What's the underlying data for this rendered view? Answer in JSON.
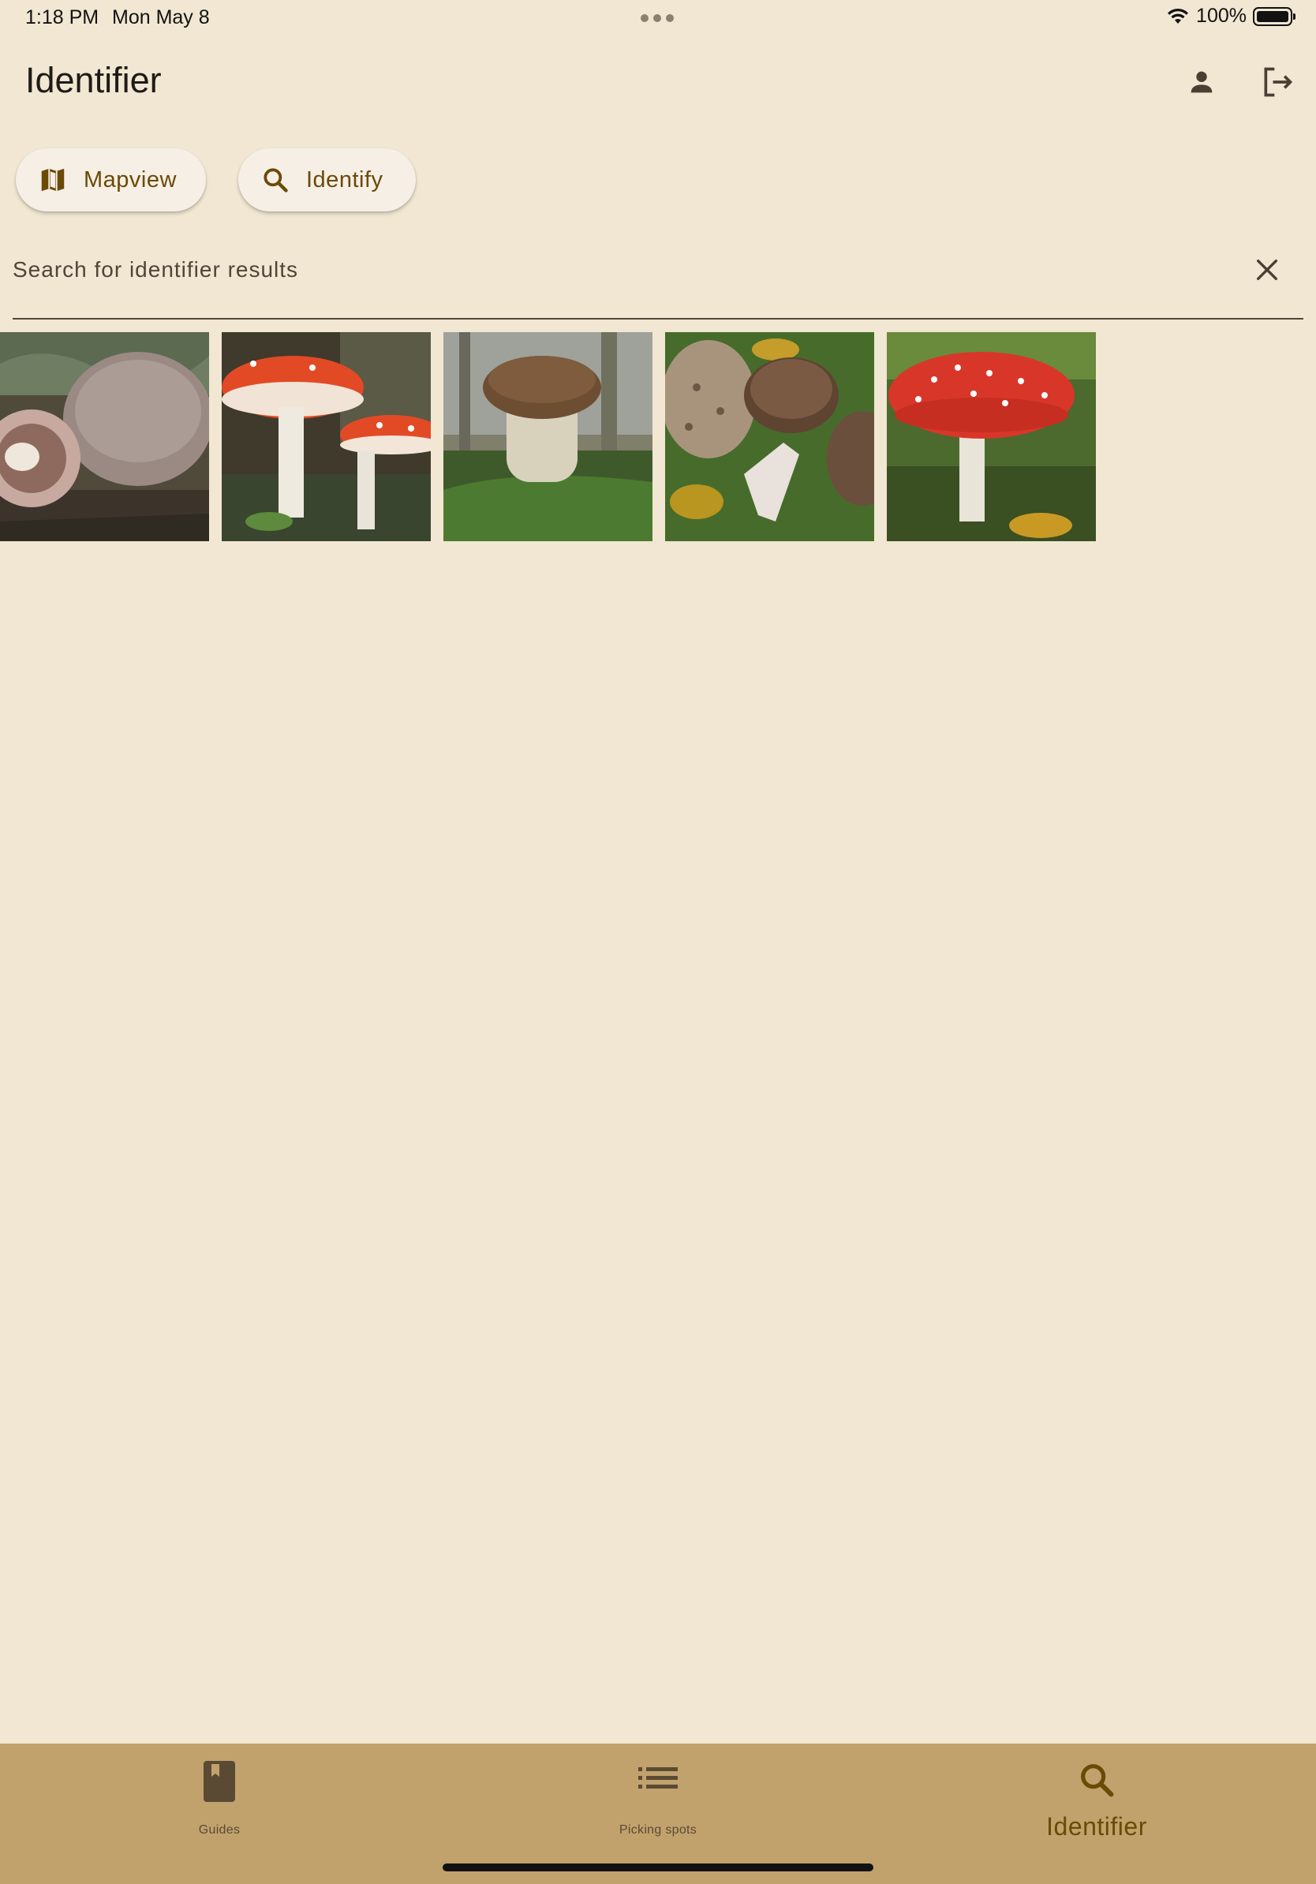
{
  "status_bar": {
    "time": "1:18 PM",
    "date": "Mon May 8",
    "battery": "100%"
  },
  "app_bar": {
    "title": "Identifier",
    "actions": [
      {
        "icon": "person-icon"
      },
      {
        "icon": "logout-icon"
      }
    ]
  },
  "chips": {
    "mapview_label": "Mapview",
    "mapview_icon": "map-icon",
    "identify_label": "Identify",
    "identify_icon": "search-icon"
  },
  "search": {
    "placeholder": "Search for identifier results",
    "value": "",
    "clear_icon": "close-icon"
  },
  "results": [
    {
      "depicts": "pale mushrooms cap and gills"
    },
    {
      "depicts": "red fly agaric pair"
    },
    {
      "depicts": "brown porcini in moss"
    },
    {
      "depicts": "speckled mushrooms cluster"
    },
    {
      "depicts": "red spotted fly agaric"
    }
  ],
  "bottom_nav": {
    "items": [
      {
        "label": "Guides",
        "icon": "book-icon",
        "selected": false
      },
      {
        "label": "Picking spots",
        "icon": "list-icon",
        "selected": false
      },
      {
        "label": "Identifier",
        "icon": "search-icon",
        "selected": true
      }
    ]
  },
  "colors": {
    "background": "#f1e7d2",
    "nav_background": "#c1a26d",
    "accent": "#6b4a06"
  }
}
